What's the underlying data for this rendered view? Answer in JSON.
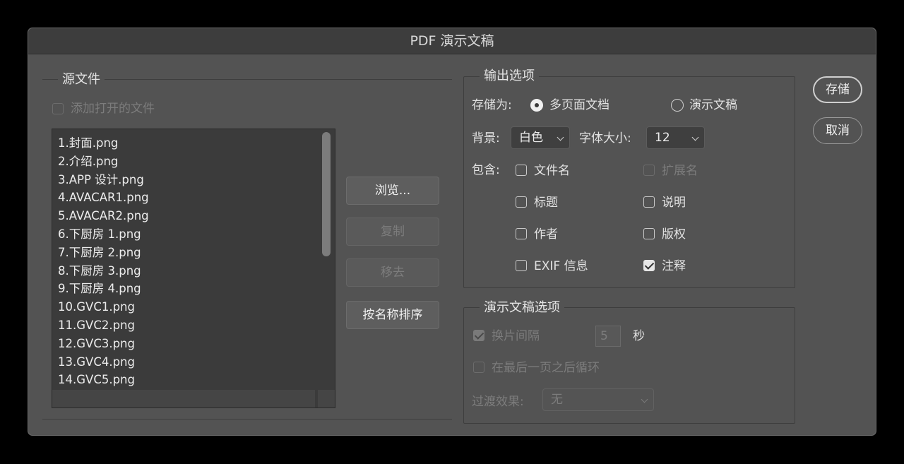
{
  "window": {
    "title": "PDF 演示文稿"
  },
  "source": {
    "title": "源文件",
    "add_open_files_label": "添加打开的文件",
    "add_open_files_checked": false,
    "files": [
      "1.封面.png",
      "2.介绍.png",
      "3.APP 设计.png",
      "4.AVACAR1.png",
      "5.AVACAR2.png",
      "6.下厨房 1.png",
      "7.下厨房 2.png",
      "8.下厨房 3.png",
      "9.下厨房 4.png",
      "10.GVC1.png",
      "11.GVC2.png",
      "12.GVC3.png",
      "13.GVC4.png",
      "14.GVC5.png"
    ],
    "buttons": {
      "browse": "浏览...",
      "duplicate": "复制",
      "remove": "移去",
      "sort": "按名称排序"
    }
  },
  "output": {
    "title": "输出选项",
    "save_as_label": "存储为:",
    "save_as_options": [
      "多页面文档",
      "演示文稿"
    ],
    "save_as_selected": "多页面文档",
    "background_label": "背景:",
    "background_value": "白色",
    "font_size_label": "字体大小:",
    "font_size_value": "12",
    "include_label": "包含:",
    "include": {
      "filename": {
        "label": "文件名",
        "checked": false
      },
      "extension": {
        "label": "扩展名",
        "checked": false,
        "disabled": true
      },
      "title": {
        "label": "标题",
        "checked": false
      },
      "description": {
        "label": "说明",
        "checked": false
      },
      "author": {
        "label": "作者",
        "checked": false
      },
      "copyright": {
        "label": "版权",
        "checked": false
      },
      "exif": {
        "label": "EXIF 信息",
        "checked": false
      },
      "notes": {
        "label": "注释",
        "checked": true
      }
    }
  },
  "presentation": {
    "title": "演示文稿选项",
    "advance_label": "换片间隔",
    "advance_checked": true,
    "advance_value": "5",
    "advance_unit": "秒",
    "loop_label": "在最后一页之后循环",
    "loop_checked": false,
    "transition_label": "过渡效果:",
    "transition_value": "无"
  },
  "actions": {
    "save": "存储",
    "cancel": "取消"
  }
}
